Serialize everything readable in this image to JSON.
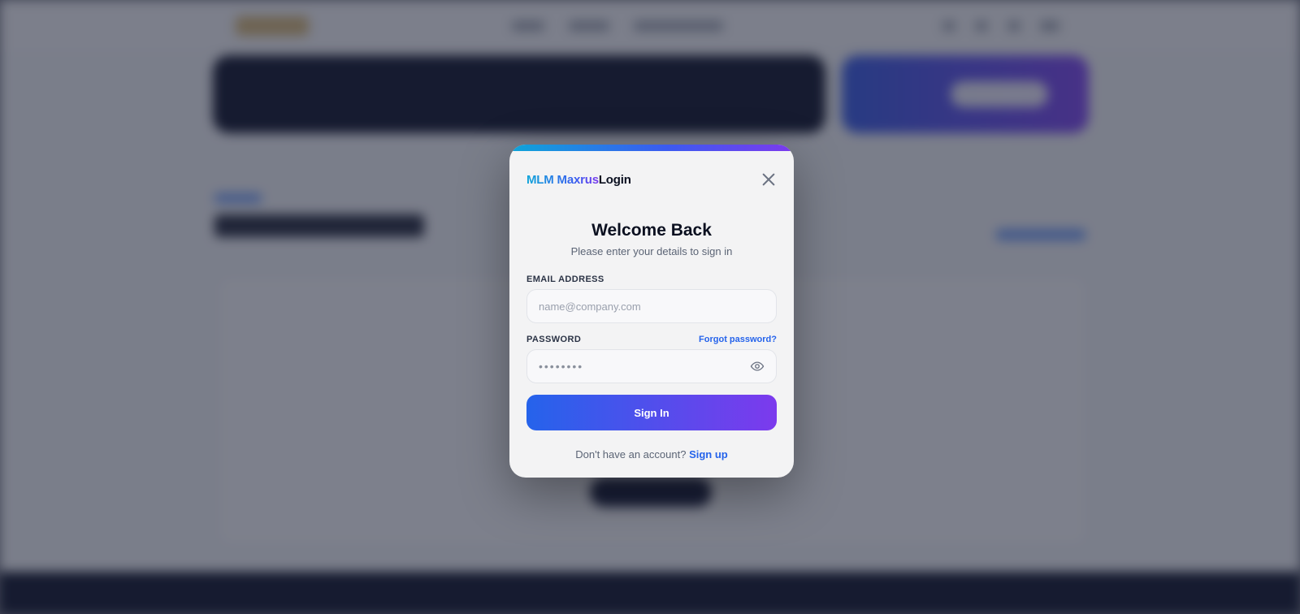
{
  "modal": {
    "brand_highlight": "MLM Maxrus",
    "brand_suffix": "Login",
    "title": "Welcome Back",
    "subtitle": "Please enter your details to sign in",
    "email": {
      "label": "EMAIL ADDRESS",
      "placeholder": "name@company.com",
      "value": ""
    },
    "password": {
      "label": "PASSWORD",
      "placeholder": "••••••••",
      "value": "",
      "forgot_label": "Forgot password?"
    },
    "submit_label": "Sign In",
    "footer_prompt": "Don't have an account?",
    "signup_label": "Sign up"
  },
  "icons": {
    "close": "close-icon",
    "password_toggle": "eye-icon"
  },
  "colors": {
    "accent_blue": "#2563eb",
    "accent_purple": "#7c3aed",
    "accent_cyan": "#0ea5d9",
    "heading": "#0b1020"
  }
}
